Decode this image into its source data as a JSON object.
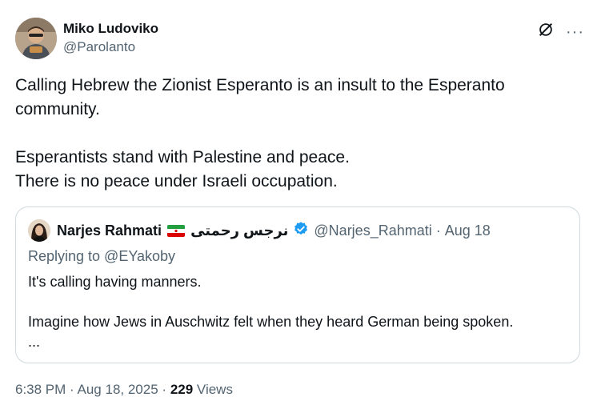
{
  "author": {
    "display_name": "Miko Ludoviko",
    "handle": "@Parolanto",
    "avatar_icon": "profile-photo"
  },
  "actions": {
    "grok_icon": "grok-icon",
    "more_label": "···"
  },
  "tweet": {
    "text": "Calling Hebrew the Zionist Esperanto is an insult to the Esperanto\ncommunity.\n\nEsperantists stand with Palestine and peace.\nThere is no peace under Israeli occupation."
  },
  "quote": {
    "display_name": "Narjes Rahmati",
    "arabic_name": "نرجس رحمتی",
    "flag_icon": "iran-flag",
    "verified_icon": "verified-badge",
    "verified_color": "#1d9bf0",
    "handle": "@Narjes_Rahmati",
    "separator": "·",
    "date": "Aug 18",
    "replying_to": "Replying to @EYakoby",
    "text": "It's calling having manners.\n\nImagine how Jews in Auschwitz felt when they heard German being spoken.\n..."
  },
  "meta": {
    "time": "6:38 PM",
    "separator": "·",
    "date": "Aug 18, 2025",
    "separator2": "·",
    "views_count": "229",
    "views_label": "Views"
  }
}
